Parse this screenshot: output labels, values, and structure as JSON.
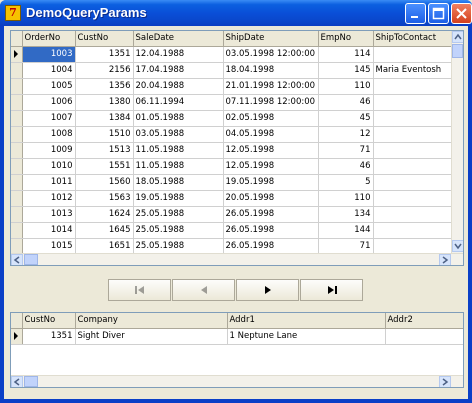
{
  "window": {
    "title": "DemoQueryParams",
    "icon_letter": "7",
    "buttons": [
      "minimize-icon",
      "maximize-icon",
      "close-icon"
    ]
  },
  "orders_grid": {
    "columns": [
      "OrderNo",
      "CustNo",
      "SaleDate",
      "ShipDate",
      "EmpNo",
      "ShipToContact"
    ],
    "rows": [
      {
        "order_no": "1003",
        "cust_no": "1351",
        "sale_date": "12.04.1988",
        "ship_date": "03.05.1998 12:00:00",
        "emp_no": "114",
        "ship_to_contact": ""
      },
      {
        "order_no": "1004",
        "cust_no": "2156",
        "sale_date": "17.04.1988",
        "ship_date": "18.04.1998",
        "emp_no": "145",
        "ship_to_contact": "Maria Eventosh"
      },
      {
        "order_no": "1005",
        "cust_no": "1356",
        "sale_date": "20.04.1988",
        "ship_date": "21.01.1998 12:00:00",
        "emp_no": "110",
        "ship_to_contact": ""
      },
      {
        "order_no": "1006",
        "cust_no": "1380",
        "sale_date": "06.11.1994",
        "ship_date": "07.11.1998 12:00:00",
        "emp_no": "46",
        "ship_to_contact": ""
      },
      {
        "order_no": "1007",
        "cust_no": "1384",
        "sale_date": "01.05.1988",
        "ship_date": "02.05.1998",
        "emp_no": "45",
        "ship_to_contact": ""
      },
      {
        "order_no": "1008",
        "cust_no": "1510",
        "sale_date": "03.05.1988",
        "ship_date": "04.05.1998",
        "emp_no": "12",
        "ship_to_contact": ""
      },
      {
        "order_no": "1009",
        "cust_no": "1513",
        "sale_date": "11.05.1988",
        "ship_date": "12.05.1998",
        "emp_no": "71",
        "ship_to_contact": ""
      },
      {
        "order_no": "1010",
        "cust_no": "1551",
        "sale_date": "11.05.1988",
        "ship_date": "12.05.1998",
        "emp_no": "46",
        "ship_to_contact": ""
      },
      {
        "order_no": "1011",
        "cust_no": "1560",
        "sale_date": "18.05.1988",
        "ship_date": "19.05.1998",
        "emp_no": "5",
        "ship_to_contact": ""
      },
      {
        "order_no": "1012",
        "cust_no": "1563",
        "sale_date": "19.05.1988",
        "ship_date": "20.05.1998",
        "emp_no": "110",
        "ship_to_contact": ""
      },
      {
        "order_no": "1013",
        "cust_no": "1624",
        "sale_date": "25.05.1988",
        "ship_date": "26.05.1998",
        "emp_no": "134",
        "ship_to_contact": ""
      },
      {
        "order_no": "1014",
        "cust_no": "1645",
        "sale_date": "25.05.1988",
        "ship_date": "26.05.1998",
        "emp_no": "144",
        "ship_to_contact": ""
      },
      {
        "order_no": "1015",
        "cust_no": "1651",
        "sale_date": "25.05.1988",
        "ship_date": "26.05.1998",
        "emp_no": "71",
        "ship_to_contact": ""
      }
    ]
  },
  "navigator": {
    "buttons": [
      {
        "name": "first-record-button",
        "icon": "first-icon",
        "enabled": false
      },
      {
        "name": "prior-record-button",
        "icon": "prior-icon",
        "enabled": false
      },
      {
        "name": "next-record-button",
        "icon": "next-icon",
        "enabled": true
      },
      {
        "name": "last-record-button",
        "icon": "last-icon",
        "enabled": true
      }
    ]
  },
  "customer_grid": {
    "columns": [
      "CustNo",
      "Company",
      "Addr1",
      "Addr2"
    ],
    "rows": [
      {
        "cust_no": "1351",
        "company": "Sight Diver",
        "addr1": "1 Neptune Lane",
        "addr2": ""
      }
    ]
  },
  "colors": {
    "title_bar": "#0a4fd8",
    "selection": "#316ac5",
    "face": "#ece9d8"
  }
}
